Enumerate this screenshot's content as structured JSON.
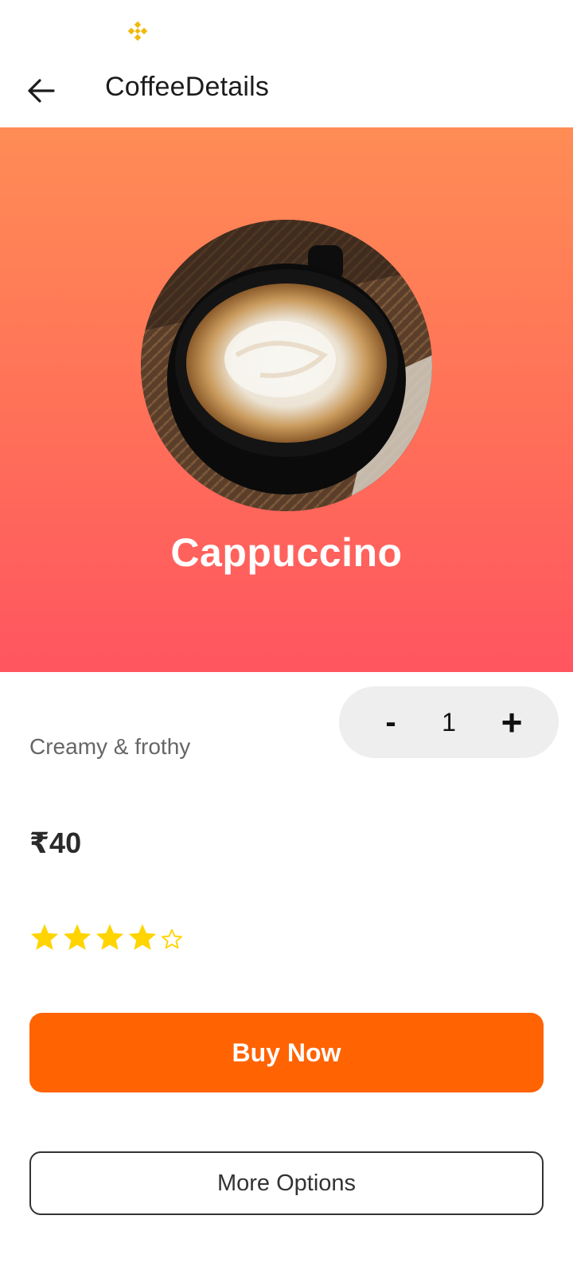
{
  "status_bar": {
    "icon": "binance-diamond-icon",
    "icon_color": "#f0b90b"
  },
  "app_bar": {
    "title": "CoffeeDetails",
    "back_icon": "arrow-left-icon"
  },
  "hero": {
    "gradient_top": "#ff8c55",
    "gradient_bottom": "#ff5560",
    "image": "cappuccino-cup-photo",
    "product_name": "Cappuccino"
  },
  "details": {
    "description": "Creamy & frothy",
    "price": "₹40",
    "quantity": {
      "minus_label": "-",
      "value": "1",
      "plus_label": "+"
    },
    "rating": {
      "value": 4,
      "max": 5,
      "star_color": "#ffd400"
    }
  },
  "actions": {
    "buy_label": "Buy Now",
    "buy_color": "#ff6302",
    "more_label": "More Options"
  }
}
